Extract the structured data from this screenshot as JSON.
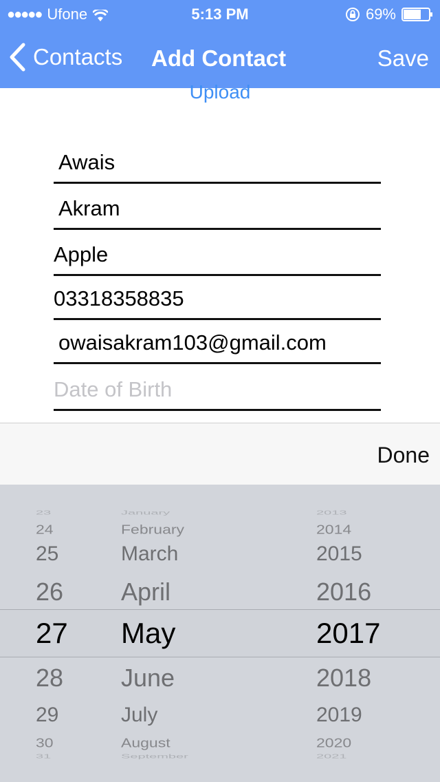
{
  "status_bar": {
    "carrier": "Ufone",
    "signal_dots": "●●●●●",
    "time": "5:13 PM",
    "battery": "69%",
    "battery_level": 0.69
  },
  "nav": {
    "back_label": "Contacts",
    "title": "Add Contact",
    "save_label": "Save"
  },
  "form": {
    "upload_label": "Upload",
    "fields": [
      {
        "value": "Awais"
      },
      {
        "value": "Akram"
      },
      {
        "value": "Apple"
      },
      {
        "value": "03318358835"
      },
      {
        "value": "owaisakram103@gmail.com"
      },
      {
        "placeholder": "Date of Birth"
      }
    ]
  },
  "toolbar": {
    "done_label": "Done"
  },
  "picker": {
    "days": [
      "23",
      "24",
      "25",
      "26",
      "27",
      "28",
      "29",
      "30",
      "31"
    ],
    "months": [
      "January",
      "February",
      "March",
      "April",
      "May",
      "June",
      "July",
      "August",
      "September"
    ],
    "years": [
      "2013",
      "2014",
      "2015",
      "2016",
      "2017",
      "2018",
      "2019",
      "2020",
      "2021"
    ],
    "selected": {
      "day": "27",
      "month": "May",
      "year": "2017"
    }
  },
  "colors": {
    "header": "#6197f7",
    "link": "#3f8ff5",
    "picker_bg": "#d2d5db",
    "toolbar_bg": "#f7f7f7"
  },
  "icons": [
    "wifi-icon",
    "orientation-lock-icon",
    "battery-icon",
    "chevron-left-icon"
  ]
}
